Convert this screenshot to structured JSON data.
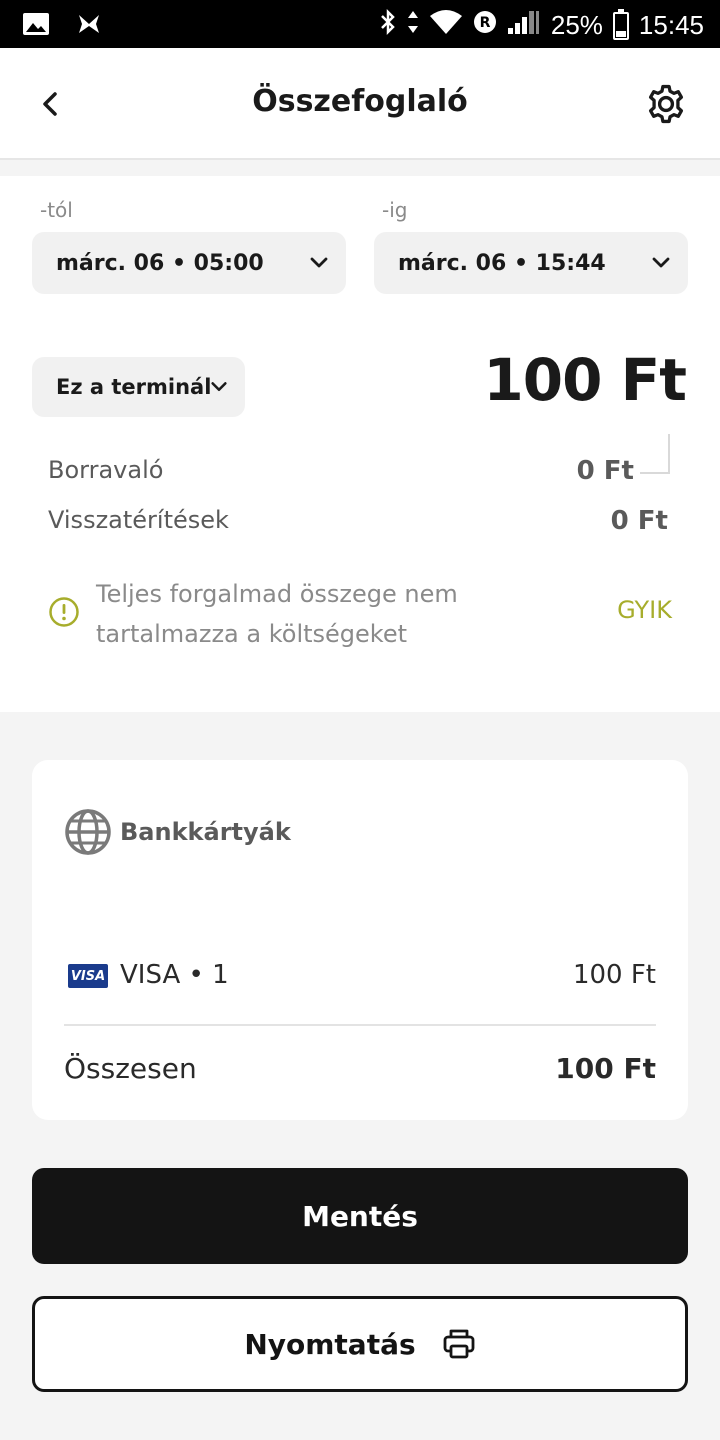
{
  "status_bar": {
    "battery": "25%",
    "time": "15:45",
    "icons": [
      "gallery-icon",
      "app-notification-icon",
      "bluetooth-icon",
      "data-arrows-icon",
      "wifi-icon",
      "roaming-icon",
      "signal-icon"
    ]
  },
  "header": {
    "title": "Összefoglaló",
    "back_icon": "chevron-left-icon",
    "settings_icon": "gear-icon"
  },
  "filters": {
    "from_label": "-tól",
    "from_value": "márc. 06 • 05:00",
    "to_label": "-ig",
    "to_value": "márc. 06 • 15:44",
    "terminal": "Ez a terminál"
  },
  "summary": {
    "total": "100 Ft",
    "tips_label": "Borravaló",
    "tips_value": "0 Ft",
    "refunds_label": "Visszatérítések",
    "refunds_value": "0 Ft",
    "notice": "Teljes forgalmad összege nem tartalmazza a költségeket",
    "faq": "GYIK"
  },
  "card": {
    "title": "Bankkártyák",
    "visa_logo": "VISA",
    "visa_label": "VISA • 1",
    "visa_amount": "100 Ft",
    "sum_label": "Összesen",
    "sum_amount": "100 Ft"
  },
  "actions": {
    "save": "Mentés",
    "print": "Nyomtatás"
  },
  "colors": {
    "accent": "#a7ad2c",
    "primary_button": "#141414",
    "visa_blue": "#1a3b8c"
  }
}
